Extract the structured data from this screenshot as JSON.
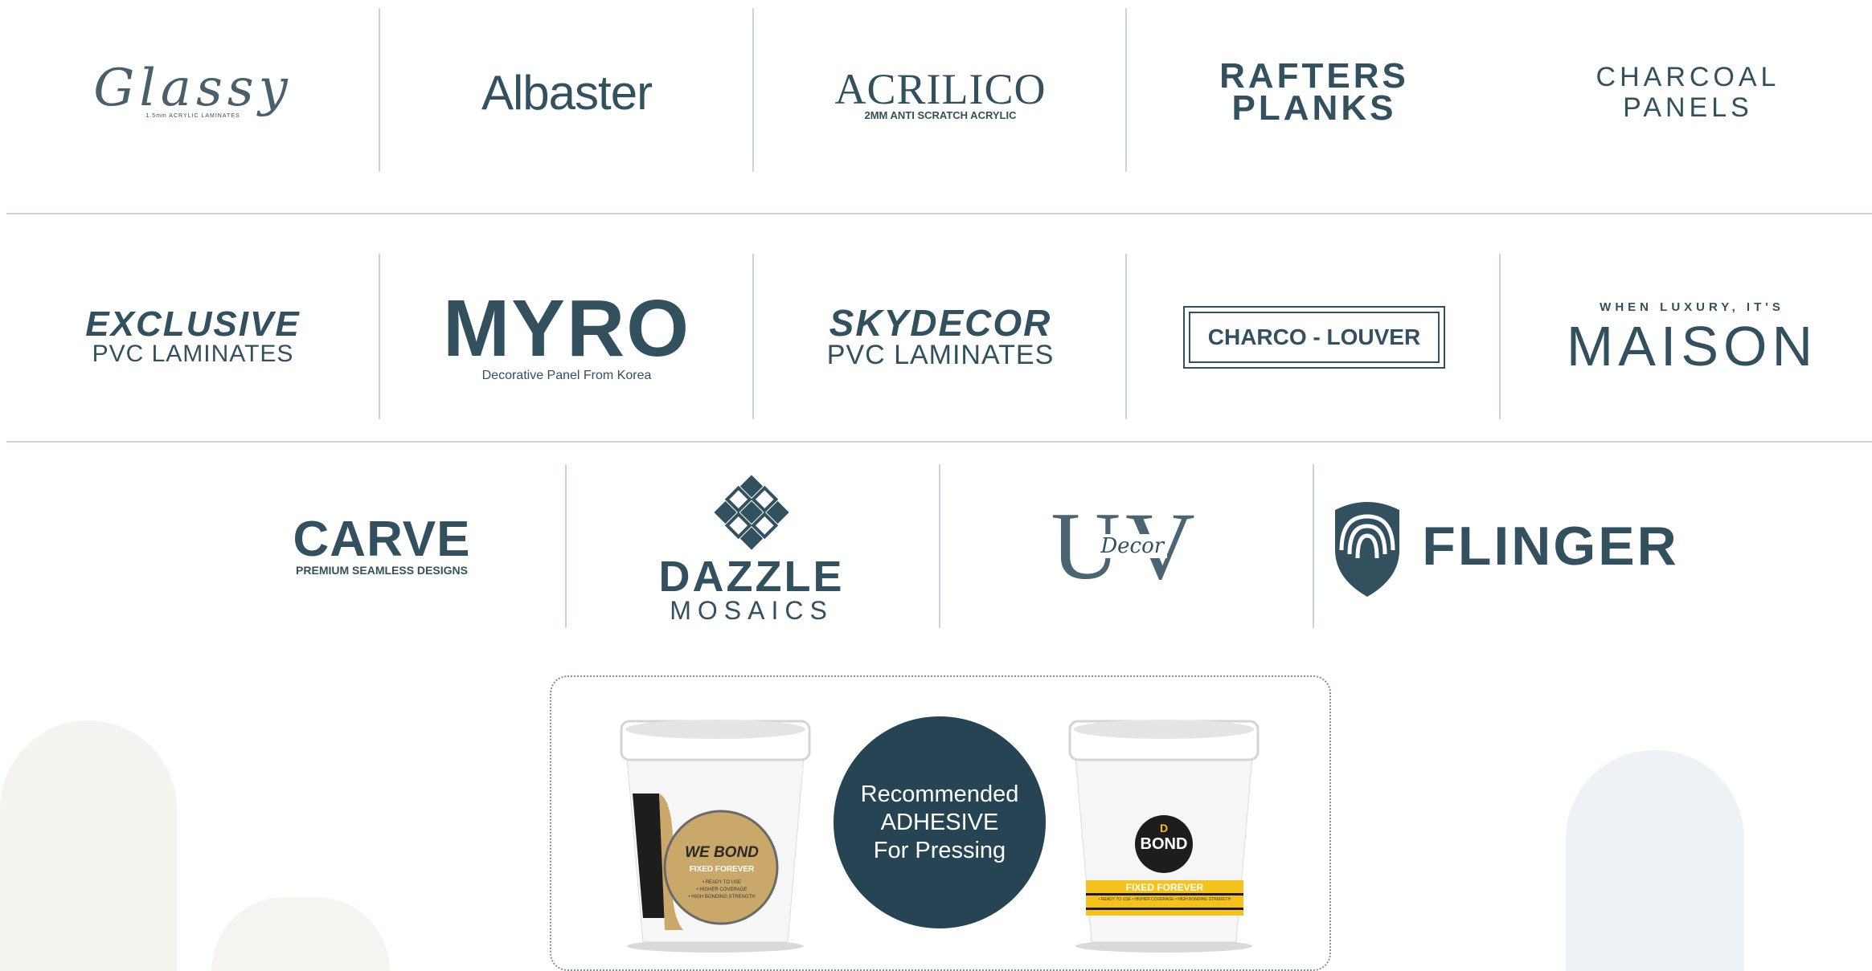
{
  "brands_row1": [
    {
      "name": "Glassy",
      "tagline": "1.5mm ACRYLIC LAMINATES"
    },
    {
      "name": "Albaster"
    },
    {
      "name": "ACRILICO",
      "tagline": "2MM ANTI SCRATCH ACRYLIC"
    },
    {
      "line1": "RAFTERS",
      "line2": "PLANKS"
    },
    {
      "line1": "CHARCOAL",
      "line2": "PANELS"
    }
  ],
  "brands_row2": [
    {
      "line1": "EXCLUSIVE",
      "line2": "PVC LAMINATES"
    },
    {
      "name": "MYRO",
      "tagline": "Decorative Panel From Korea"
    },
    {
      "line1": "SKYDECOR",
      "line2": "PVC LAMINATES"
    },
    {
      "name": "CHARCO - LOUVER"
    },
    {
      "tagline": "WHEN LUXURY, IT'S",
      "name": "MAISON"
    }
  ],
  "brands_row3": [
    {
      "name": "CARVE",
      "tagline": "PREMIUM SEAMLESS DESIGNS"
    },
    {
      "name": "DAZZLE",
      "tagline": "MOSAICS"
    },
    {
      "name": "UV",
      "script": "Decor"
    },
    {
      "name": "FLINGER"
    }
  ],
  "adhesive": {
    "line1": "Recommended",
    "line2": "ADHESIVE",
    "line3": "For Pressing",
    "bucket_left": {
      "brand": "WE BOND",
      "sub": "FIXED FOREVER",
      "bullets": [
        "• READY TO USE",
        "• HIGHER COVERAGE",
        "• HIGH BONDING STRENGTH"
      ]
    },
    "bucket_right": {
      "brand_d": "D",
      "brand": "BOND",
      "sub": "FIXED FOREVER",
      "bullets": "• READY TO USE • HIGHER COVERAGE • HIGH BONDING STRENGTH"
    }
  },
  "colors": {
    "primary": "#2f4a5a",
    "divider": "#c7d4de",
    "circle": "#264454",
    "gold": "#c9a86a",
    "yellow": "#f4c21a"
  }
}
